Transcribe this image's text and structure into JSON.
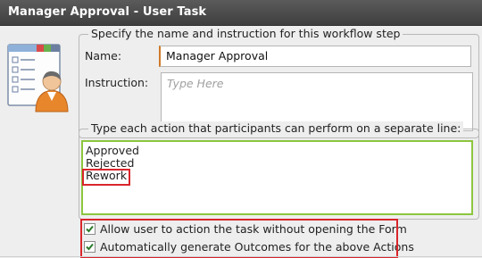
{
  "window": {
    "title": "Manager Approval - User Task"
  },
  "icons": {
    "task_icon": "user-task-icon",
    "checkbox_checked": "checkmark-icon"
  },
  "step_group": {
    "legend": "Specify the name and instruction for this workflow step",
    "name_label": "Name:",
    "name_value": "Manager Approval",
    "instruction_label": "Instruction:",
    "instruction_placeholder": "Type Here"
  },
  "actions_group": {
    "legend": "Type each action that participants can perform on a separate line:",
    "actions": [
      "Approved",
      "Rejected",
      "Rework"
    ]
  },
  "options": {
    "allow_action_without_form": {
      "label": "Allow user to action the task without opening the Form",
      "checked": true
    },
    "auto_generate_outcomes": {
      "label": "Automatically generate Outcomes for the above Actions",
      "checked": true
    }
  },
  "colors": {
    "highlight": "#d9262b",
    "focus_green": "#8cc63f",
    "title_bg": "#4a4a4a"
  }
}
